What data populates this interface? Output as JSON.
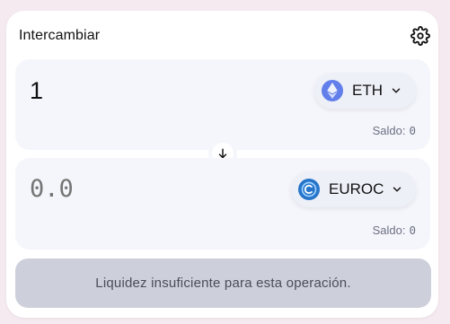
{
  "header": {
    "title": "Intercambiar",
    "settings_icon": "gear-icon"
  },
  "from": {
    "amount": "1",
    "token": {
      "symbol": "ETH",
      "icon": "eth-icon",
      "color": "#627eea"
    },
    "balance_label": "Saldo:",
    "balance_value": "0"
  },
  "to": {
    "amount_placeholder": "0.0",
    "token": {
      "symbol": "EUROC",
      "icon": "euroc-icon",
      "color": "#2775ca"
    },
    "balance_label": "Saldo:",
    "balance_value": "0"
  },
  "swap_arrow_icon": "arrow-down-icon",
  "action_button": {
    "label": "Liquidez insuficiente para esta operación."
  }
}
